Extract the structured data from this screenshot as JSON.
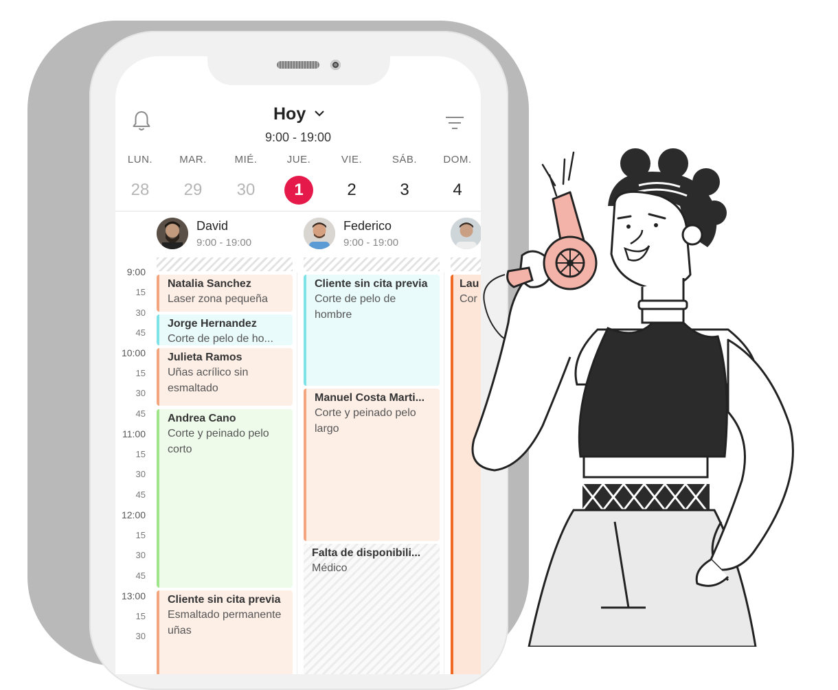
{
  "header": {
    "title": "Hoy",
    "hours": "9:00 - 19:00"
  },
  "days": [
    {
      "name": "LUN.",
      "date": "28"
    },
    {
      "name": "MAR.",
      "date": "29"
    },
    {
      "name": "MIÉ.",
      "date": "30"
    },
    {
      "name": "JUE.",
      "date": "1"
    },
    {
      "name": "VIE.",
      "date": "2"
    },
    {
      "name": "SÁB.",
      "date": "3"
    },
    {
      "name": "DOM.",
      "date": "4"
    }
  ],
  "staff": [
    {
      "name": "David",
      "hours": "9:00 - 19:00"
    },
    {
      "name": "Federico",
      "hours": "9:00 - 19:00"
    }
  ],
  "times": [
    "9:00",
    "15",
    "30",
    "45",
    "10:00",
    "15",
    "30",
    "45",
    "11:00",
    "15",
    "30",
    "45",
    "12:00",
    "15",
    "30",
    "45",
    "13:00",
    "15",
    "30"
  ],
  "appointments": {
    "a1": {
      "client": "Natalia Sanchez",
      "service": "Laser zona pequeña"
    },
    "a2": {
      "client": "Jorge Hernandez",
      "service": "Corte de pelo de ho..."
    },
    "a3": {
      "client": "Julieta Ramos",
      "service": "Uñas acrílico sin esmaltado"
    },
    "a4": {
      "client": "Andrea Cano",
      "service": "Corte y peinado pelo corto"
    },
    "a5": {
      "client": "Cliente sin cita previa",
      "service": "Esmaltado permanente uñas"
    },
    "b1": {
      "client": "Cliente sin cita previa",
      "service": "Corte de pelo de hombre"
    },
    "b2": {
      "client": "Manuel Costa Marti...",
      "service": "Corte y peinado pelo largo"
    },
    "b3": {
      "client": "Falta de disponibili...",
      "service": "Médico"
    },
    "c1": {
      "client": "Lau",
      "service": "Cor"
    }
  },
  "colors": {
    "today": "#e6194b",
    "salmon": "#f2a57f",
    "cyan": "#7de3e6",
    "green": "#9fe58a",
    "orange": "#f06a23",
    "dryer": "#f4b3a8"
  },
  "icons": {
    "notifications": "bell-icon",
    "filter": "filter-icon",
    "dropdown": "chevron-down-icon"
  }
}
